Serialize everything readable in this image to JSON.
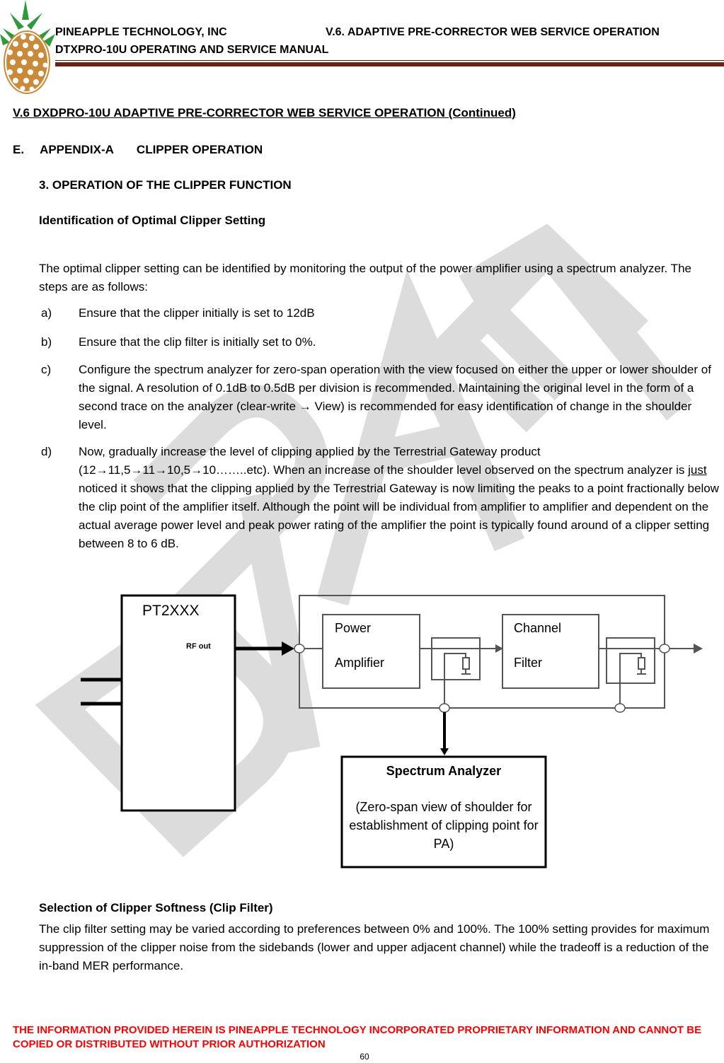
{
  "header": {
    "company": "PINEAPPLE TECHNOLOGY, INC",
    "section": "V.6. ADAPTIVE PRE-CORRECTOR WEB SERVICE OPERATION",
    "manual": "DTXPRO-10U OPERATING AND SERVICE MANUAL",
    "logo_icon": "pineapple-logo-icon",
    "rule_color": "#6b2019"
  },
  "watermark": {
    "text": "DRAFT",
    "color": "#dcdcdc"
  },
  "document": {
    "section_title": "V.6  DXDPRO-10U ADAPTIVE PRE-CORRECTOR WEB SERVICE OPERATION (Continued)",
    "appendix": {
      "letter": "E.",
      "label": "APPENDIX-A",
      "title": "CLIPPER OPERATION"
    },
    "subsection": "3. OPERATION OF THE CLIPPER FUNCTION",
    "heading_ident": "Identification of Optimal Clipper Setting",
    "intro": "The optimal clipper setting can be identified by monitoring the output of the power amplifier using a spectrum analyzer. The steps are as follows:",
    "steps": [
      {
        "marker": "a)",
        "text": "Ensure that the clipper initially is set to 12dB"
      },
      {
        "marker": "b)",
        "text": "Ensure that the clip filter is initially set to 0%."
      },
      {
        "marker": "c)",
        "text": "Configure the spectrum analyzer for zero-span operation with the view focused on either the upper or lower shoulder of the signal. A resolution of 0.1dB to 0.5dB per division is recommended. Maintaining the original level in the form of a second trace on the analyzer (clear-write → View) is recommended for easy identification of change in the shoulder level."
      },
      {
        "marker": "d)",
        "text_before": "Now, gradually increase the level of clipping applied by the Terrestrial Gateway product (12→11,5→11→10,5→10……..etc). When an increase of the shoulder level observed on the spectrum analyzer is ",
        "text_underlined": "just",
        "text_after": " noticed it shows that the clipping applied by the Terrestrial Gateway is now limiting the peaks to a point fractionally below the clip point of the amplifier itself. Although the point will be individual from amplifier to amplifier and dependent on the actual average power level and peak power rating of the amplifier the point is typically found around of a clipper setting between 8 to 6 dB."
      }
    ],
    "diagram": {
      "device": "PT2XXX",
      "rf_out": "RF out",
      "power_amplifier": [
        "Power",
        "Amplifier"
      ],
      "channel_filter": [
        "Channel",
        "Filter"
      ],
      "spectrum_analyzer_title": "Spectrum Analyzer",
      "spectrum_analyzer_desc": "(Zero-span view of shoulder for establishment of clipping point for PA)"
    },
    "heading_selection": "Selection of Clipper Softness (Clip Filter)",
    "clip_filter_text": "The clip filter setting may be varied according to preferences between 0% and 100%. The 100% setting provides for maximum suppression of the clipper noise from the sidebands (lower and upper adjacent channel) while the tradeoff is a reduction of the in-band MER performance."
  },
  "footer": {
    "notice": "THE INFORMATION PROVIDED HEREIN IS PINEAPPLE TECHNOLOGY INCORPORATED PROPRIETARY INFORMATION AND CANNOT BE COPIED OR DISTRIBUTED WITHOUT PRIOR AUTHORIZATION",
    "page_number": "60",
    "notice_color": "#ff0000"
  }
}
